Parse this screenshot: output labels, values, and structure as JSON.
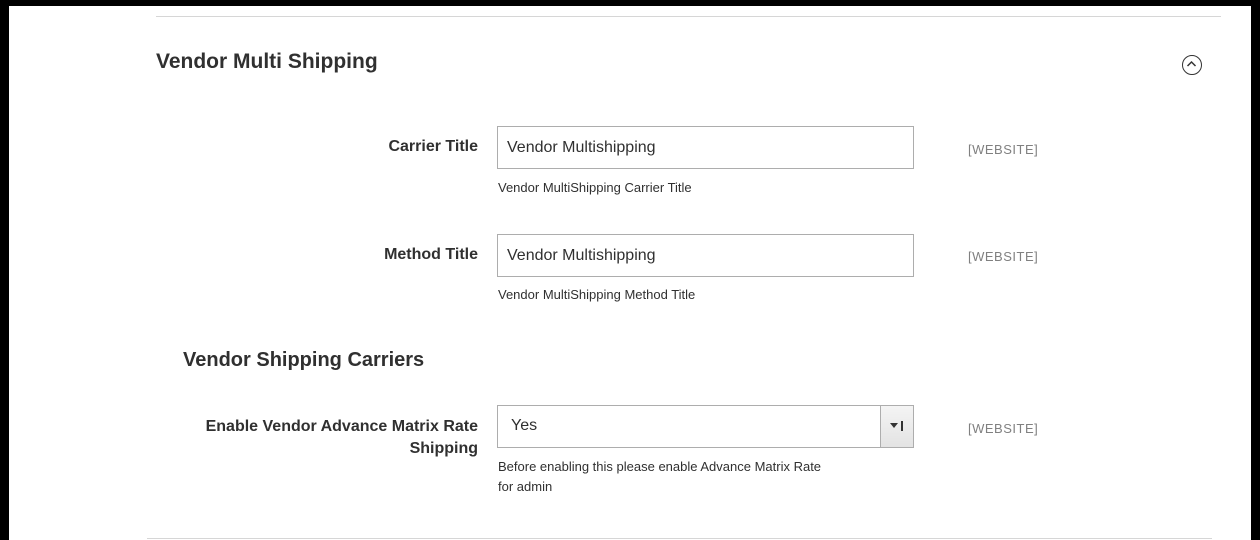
{
  "section": {
    "title": "Vendor Multi Shipping",
    "collapse_icon": "chevron-up-circle-icon"
  },
  "fields": {
    "carrier_title": {
      "label": "Carrier Title",
      "value": "Vendor Multishipping",
      "note": "Vendor MultiShipping Carrier Title",
      "scope": "[WEBSITE]"
    },
    "method_title": {
      "label": "Method Title",
      "value": "Vendor Multishipping",
      "note": "Vendor MultiShipping Method Title",
      "scope": "[WEBSITE]"
    },
    "group_title": "Vendor Shipping Carriers",
    "advance_matrix": {
      "label_line1": "Enable Vendor Advance Matrix Rate",
      "label_line2": "Shipping",
      "selected": "Yes",
      "note_line1": "Before enabling this please enable Advance Matrix Rate",
      "note_line2": "for admin",
      "scope": "[WEBSITE]"
    }
  }
}
